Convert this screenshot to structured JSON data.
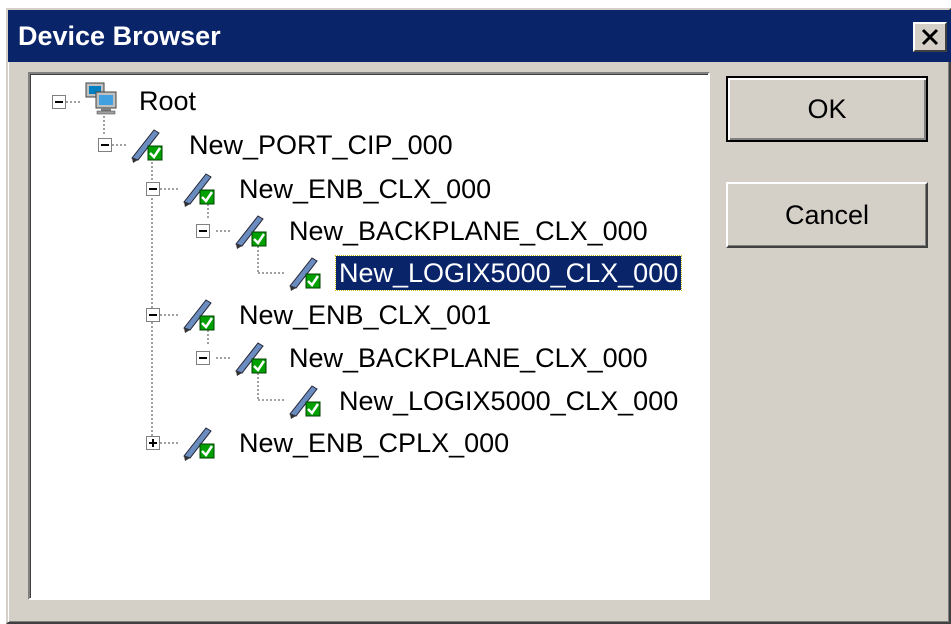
{
  "window": {
    "title": "Device Browser",
    "close_label": "✕"
  },
  "buttons": {
    "ok_label": "OK",
    "cancel_label": "Cancel"
  },
  "colors": {
    "titlebar": "#0a246a",
    "selection": "#0a246a",
    "dialog_face": "#d4d0c8"
  },
  "tree": {
    "nodes": [
      {
        "label": "Root",
        "icon": "computer-network-icon",
        "expanded": true
      },
      {
        "label": "New_PORT_CIP_000",
        "icon": "device-pen-check-icon",
        "expanded": true
      },
      {
        "label": "New_ENB_CLX_000",
        "icon": "device-pen-check-icon",
        "expanded": true
      },
      {
        "label": "New_BACKPLANE_CLX_000",
        "icon": "device-pen-check-icon",
        "expanded": true
      },
      {
        "label": "New_LOGIX5000_CLX_000",
        "icon": "device-pen-check-icon",
        "selected": true
      },
      {
        "label": "New_ENB_CLX_001",
        "icon": "device-pen-check-icon",
        "expanded": true
      },
      {
        "label": "New_BACKPLANE_CLX_000",
        "icon": "device-pen-check-icon",
        "expanded": true
      },
      {
        "label": "New_LOGIX5000_CLX_000",
        "icon": "device-pen-check-icon"
      },
      {
        "label": "New_ENB_CPLX_000",
        "icon": "device-pen-check-icon",
        "expanded": false
      }
    ]
  }
}
